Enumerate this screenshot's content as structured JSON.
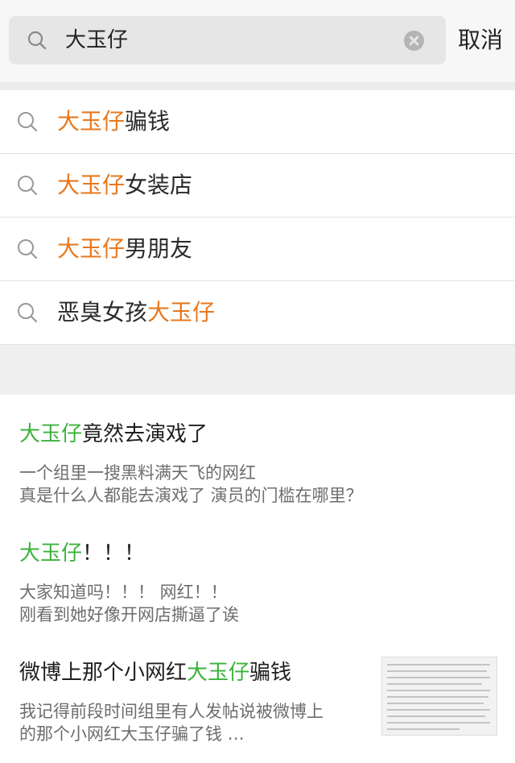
{
  "search": {
    "query": "大玉仔",
    "cancel_label": "取消"
  },
  "suggestions": [
    {
      "prefix": "",
      "highlight": "大玉仔",
      "suffix": "骗钱"
    },
    {
      "prefix": "",
      "highlight": "大玉仔",
      "suffix": "女装店"
    },
    {
      "prefix": "",
      "highlight": "大玉仔",
      "suffix": "男朋友"
    },
    {
      "prefix": "恶臭女孩",
      "highlight": "大玉仔",
      "suffix": ""
    }
  ],
  "results": [
    {
      "title_highlight": "大玉仔",
      "title_rest": "竟然去演戏了",
      "desc_line1": "一个组里一搜黑料满天飞的网红",
      "desc_line2": "真是什么人都能去演戏了 演员的门槛在哪里？"
    },
    {
      "title_highlight": "大玉仔",
      "title_rest": "！！！",
      "desc_line1": "大家知道吗！！！ 网红！！",
      "desc_line2": "刚看到她好像开网店撕逼了诶"
    },
    {
      "title_prefix": "微博上那个小网红",
      "title_highlight": "大玉仔",
      "title_rest": "骗钱",
      "desc_line1": "我记得前段时间组里有人发帖说被微博上",
      "desc_line2": "的那个小网红大玉仔骗了钱 …"
    }
  ],
  "colors": {
    "suggestion_highlight": "#e8781d",
    "result_highlight": "#3cb23c"
  }
}
